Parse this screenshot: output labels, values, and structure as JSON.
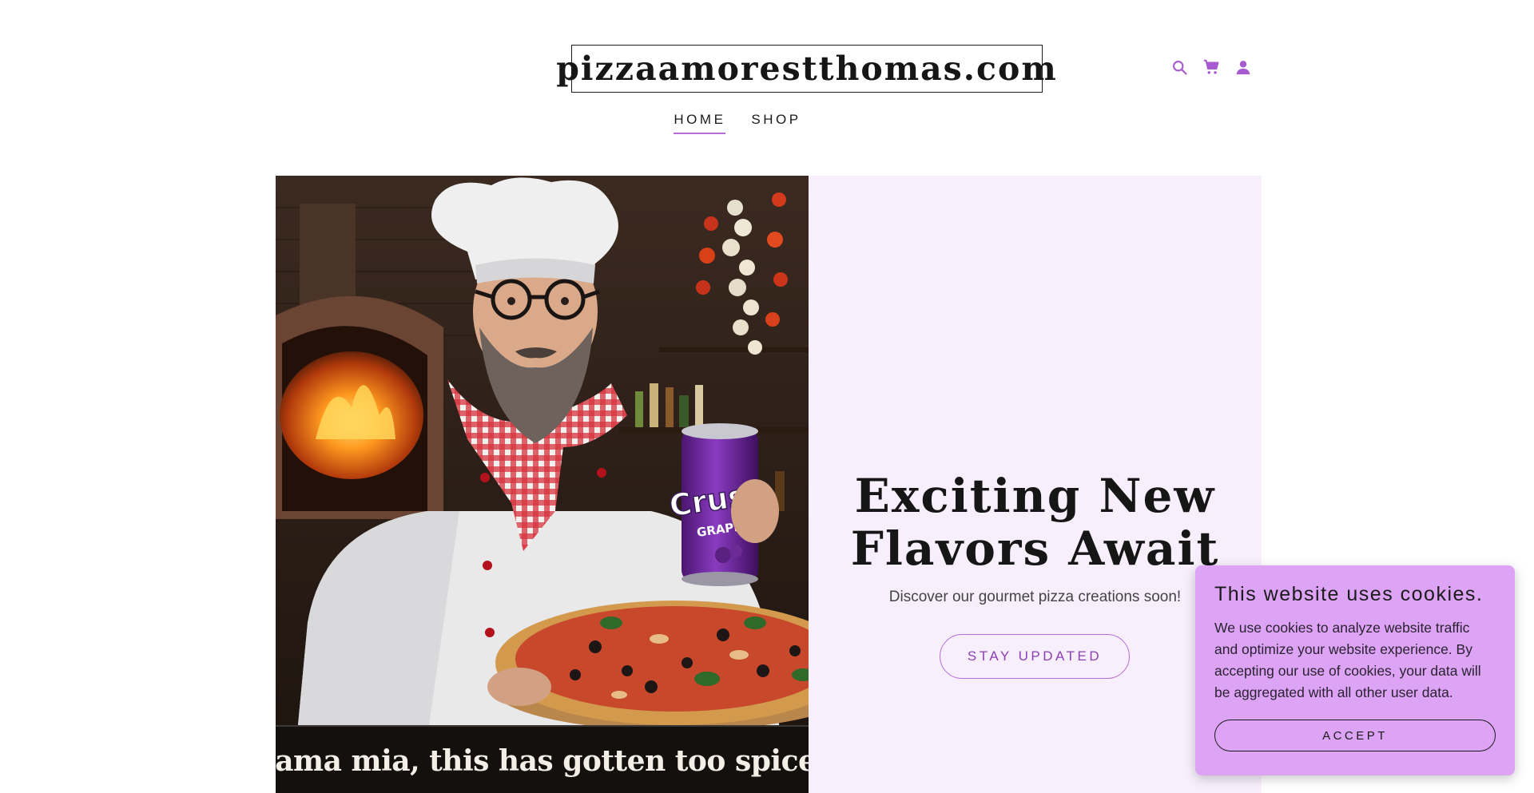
{
  "site": {
    "logo_text": "pizzaamorestthomas.com"
  },
  "header": {
    "icons": [
      "search-icon",
      "cart-icon",
      "account-icon"
    ],
    "accent_color": "#b56cd6"
  },
  "nav": {
    "items": [
      {
        "label": "HOME",
        "active": true
      },
      {
        "label": "SHOP",
        "active": false
      }
    ]
  },
  "hero": {
    "image_caption": "mama mia, this has gotten too spicey,",
    "can_label_brand": "Crush",
    "can_label_flavor": "GRAPE",
    "title_line1": "Exciting New",
    "title_line2": "Flavors Await",
    "subtitle": "Discover our gourmet pizza creations soon!",
    "cta_label": "STAY UPDATED",
    "panel_color": "#f8effd"
  },
  "cookie_banner": {
    "title": "This website uses cookies.",
    "body": "We use cookies to analyze website traffic and optimize your website experience. By accepting our use of cookies, your data will be aggregated with all other user data.",
    "accept_label": "ACCEPT",
    "background_color": "#dda4f5"
  }
}
